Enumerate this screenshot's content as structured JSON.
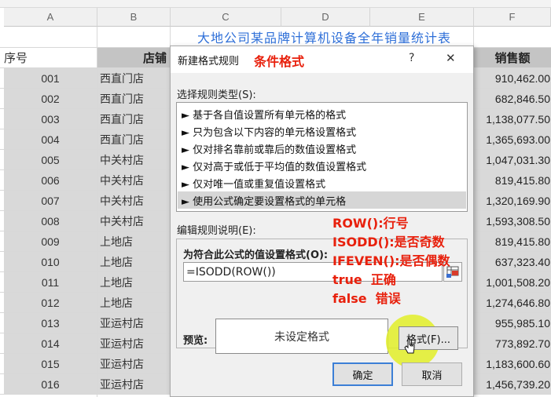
{
  "sheet": {
    "columns": [
      "A",
      "B",
      "C",
      "D",
      "E",
      "F"
    ],
    "title": "大地公司某品牌计算机设备全年销量统计表",
    "headers": {
      "seq": "序号",
      "store": "店铺",
      "sales": "销售额"
    },
    "rows": [
      {
        "seq": "001",
        "store": "西直门店",
        "sales": "910,462.00"
      },
      {
        "seq": "002",
        "store": "西直门店",
        "sales": "682,846.50"
      },
      {
        "seq": "003",
        "store": "西直门店",
        "sales": "1,138,077.50"
      },
      {
        "seq": "004",
        "store": "西直门店",
        "sales": "1,365,693.00"
      },
      {
        "seq": "005",
        "store": "中关村店",
        "sales": "1,047,031.30"
      },
      {
        "seq": "006",
        "store": "中关村店",
        "sales": "819,415.80"
      },
      {
        "seq": "007",
        "store": "中关村店",
        "sales": "1,320,169.90"
      },
      {
        "seq": "008",
        "store": "中关村店",
        "sales": "1,593,308.50"
      },
      {
        "seq": "009",
        "store": "上地店",
        "sales": "819,415.80"
      },
      {
        "seq": "010",
        "store": "上地店",
        "sales": "637,323.40"
      },
      {
        "seq": "011",
        "store": "上地店",
        "sales": "1,001,508.20"
      },
      {
        "seq": "012",
        "store": "上地店",
        "sales": "1,274,646.80"
      },
      {
        "seq": "013",
        "store": "亚运村店",
        "sales": "955,985.10"
      },
      {
        "seq": "014",
        "store": "亚运村店",
        "sales": "773,892.70"
      },
      {
        "seq": "015",
        "store": "亚运村店",
        "sales": "1,183,600.60"
      },
      {
        "seq": "016",
        "store": "亚运村店",
        "sales": "1,456,739.20"
      }
    ]
  },
  "dialog": {
    "title": "新建格式规则",
    "annotation": "条件格式",
    "help": "?",
    "close": "✕",
    "select_label": "选择规则类型(S):",
    "rule_types": [
      "► 基于各自值设置所有单元格的格式",
      "► 只为包含以下内容的单元格设置格式",
      "► 仅对排名靠前或靠后的数值设置格式",
      "► 仅对高于或低于平均值的数值设置格式",
      "► 仅对唯一值或重复值设置格式",
      "► 使用公式确定要设置格式的单元格"
    ],
    "edit_label": "编辑规则说明(E):",
    "formula_label": "为符合此公式的值设置格式(O):",
    "formula_value": "=ISODD(ROW())",
    "preview_label": "预览:",
    "preview_text": "未设定格式",
    "format_button": "格式(F)...",
    "ok_button": "确定",
    "cancel_button": "取消",
    "notes": [
      "ROW():行号",
      "ISODD():是否奇数",
      "IFEVEN():是否偶数",
      "true  正确",
      "false  错误"
    ]
  },
  "colors": {
    "title_blue": "#2e6fd8",
    "annotation_red": "#e8200c",
    "selected_row": "#d6d6d6",
    "highlight_circle": "#e4ef3a"
  }
}
